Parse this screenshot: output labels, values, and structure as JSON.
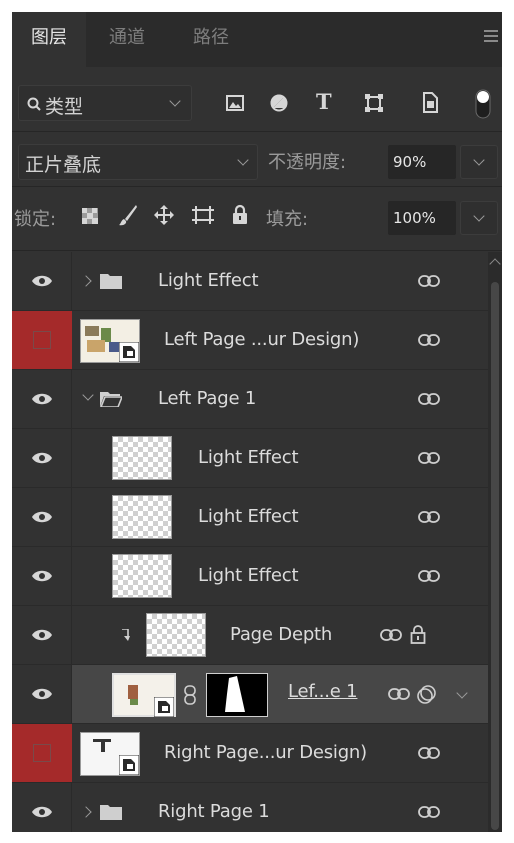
{
  "tabs": [
    {
      "label": "图层",
      "active": true
    },
    {
      "label": "通道",
      "active": false
    },
    {
      "label": "路径",
      "active": false
    }
  ],
  "filter": {
    "kind_label": "类型",
    "icons": [
      "image-filter-icon",
      "adjustment-filter-icon",
      "type-filter-icon",
      "shape-filter-icon",
      "smart-object-filter-icon",
      "filter-toggle-icon"
    ],
    "type_glyph": "T"
  },
  "blend": {
    "mode": "正片叠底",
    "opacity_label": "不透明度:",
    "opacity_value": "90%"
  },
  "lock": {
    "label": "锁定:",
    "fill_label": "填充:",
    "fill_value": "100%"
  },
  "layers": [
    {
      "name": "Light Effect",
      "kind": "group",
      "expanded": false,
      "visible": true
    },
    {
      "name": "Left Page ...ur Design)",
      "kind": "smart-object",
      "visible": false
    },
    {
      "name": "Left Page 1",
      "kind": "group",
      "expanded": true,
      "visible": true
    },
    {
      "name": "Light Effect",
      "kind": "pixel",
      "visible": true
    },
    {
      "name": "Light Effect",
      "kind": "pixel",
      "visible": true
    },
    {
      "name": "Light Effect",
      "kind": "pixel",
      "visible": true
    },
    {
      "name": "Page Depth",
      "kind": "clipped-pixel",
      "visible": true,
      "locked": true
    },
    {
      "name": "Lef...e 1",
      "kind": "smart-object-mask",
      "visible": true,
      "selected": true
    },
    {
      "name": "Right Page...ur Design)",
      "kind": "smart-object",
      "visible": false
    },
    {
      "name": "Right Page 1",
      "kind": "group",
      "expanded": false,
      "visible": true
    }
  ],
  "colors": {
    "panel_bg": "#323232",
    "selected_row": "#474747",
    "hidden_eye_bg": "#a52a2a",
    "text": "#dcdcdc"
  }
}
